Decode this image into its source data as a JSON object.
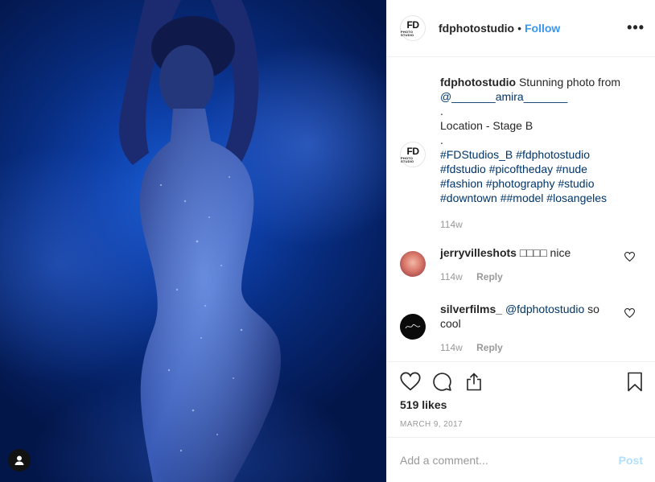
{
  "header": {
    "username": "fdphotostudio",
    "separator": "•",
    "follow_label": "Follow",
    "more_label": "•••",
    "avatar_text_big": "FD",
    "avatar_text_small": "PHOTO STUDIO"
  },
  "caption": {
    "username": "fdphotostudio",
    "text": "Stunning photo from",
    "mention": "@_______amira_______",
    "dot1": ".",
    "location": "Location - Stage B",
    "dot2": ".",
    "hashtags_line1": "#FDStudios_B #fdphotostudio",
    "hashtags_line2": "#fdstudio #picoftheday #nude",
    "hashtags_line3": "#fashion #photography #studio",
    "hashtags_line4": "#downtown ##model #losangeles",
    "time": "114w"
  },
  "comments": [
    {
      "username": "jerryvilleshots",
      "text": "□□□□ nice",
      "time": "114w",
      "reply_label": "Reply"
    },
    {
      "username": "silverfilms_",
      "mention": "@fdphotostudio",
      "text": "so cool",
      "time": "114w",
      "reply_label": "Reply"
    }
  ],
  "actions": {
    "likes": "519 likes",
    "date": "MARCH 9, 2017"
  },
  "add_comment": {
    "placeholder": "Add a comment...",
    "post_label": "Post"
  },
  "colors": {
    "link_blue": "#3897f0",
    "mention_blue": "#003569",
    "muted": "#999999",
    "photo_blue": "#0d3fa8"
  }
}
